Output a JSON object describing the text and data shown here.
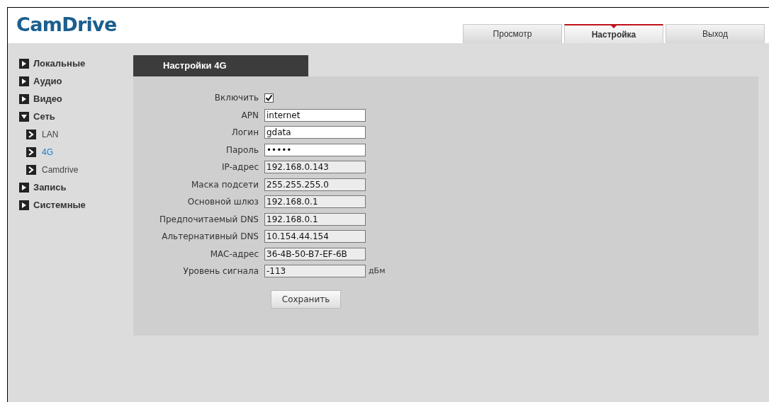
{
  "logo": "CamDrive",
  "tabs": [
    {
      "label": "Просмотр",
      "selected": false
    },
    {
      "label": "Настройка",
      "selected": true
    },
    {
      "label": "Выход",
      "selected": false
    }
  ],
  "sidebar": {
    "items": [
      {
        "label": "Локальные",
        "expanded": false
      },
      {
        "label": "Аудио",
        "expanded": false
      },
      {
        "label": "Видео",
        "expanded": false
      },
      {
        "label": "Сеть",
        "expanded": true,
        "children": [
          {
            "label": "LAN",
            "selected": false
          },
          {
            "label": "4G",
            "selected": true
          },
          {
            "label": "Camdrive",
            "selected": false
          }
        ]
      },
      {
        "label": "Запись",
        "expanded": false
      },
      {
        "label": "Системные",
        "expanded": false
      }
    ]
  },
  "panel": {
    "title": "Настройки 4G",
    "fields": [
      {
        "kind": "checkbox",
        "label": "Включить",
        "checked": true
      },
      {
        "kind": "text",
        "label": "APN",
        "value": "internet"
      },
      {
        "kind": "text",
        "label": "Логин",
        "value": "gdata"
      },
      {
        "kind": "text",
        "label": "Пароль",
        "value": "•••••"
      },
      {
        "kind": "readonly",
        "label": "IP-адрес",
        "value": "192.168.0.143"
      },
      {
        "kind": "readonly",
        "label": "Маска подсети",
        "value": "255.255.255.0"
      },
      {
        "kind": "readonly",
        "label": "Основной шлюз",
        "value": "192.168.0.1"
      },
      {
        "kind": "readonly",
        "label": "Предпочитаемый DNS",
        "value": "192.168.0.1"
      },
      {
        "kind": "readonly",
        "label": "Альтернативный DNS",
        "value": "10.154.44.154"
      },
      {
        "kind": "readonly",
        "label": "MAC-адрес",
        "value": "36-4B-50-B7-EF-6B"
      },
      {
        "kind": "readonly",
        "label": "Уровень сигнала",
        "value": "-113",
        "unit": "дБм"
      }
    ],
    "save_button": "Сохранить"
  }
}
